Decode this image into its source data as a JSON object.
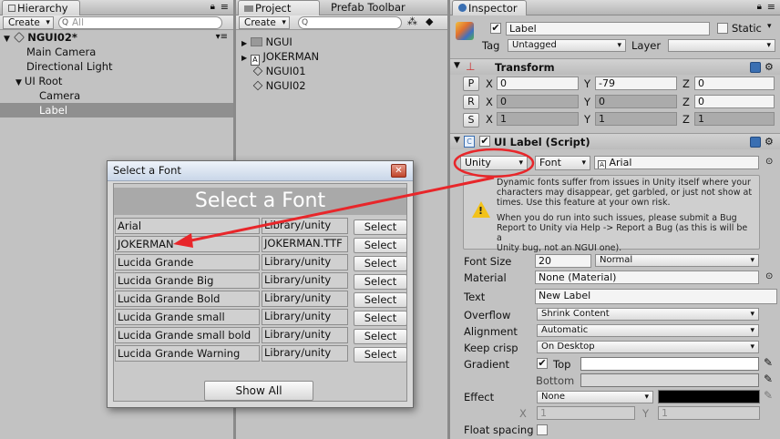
{
  "hierarchy": {
    "tab": "Hierarchy",
    "create": "Create",
    "search_placeholder": "All",
    "scene": "NGUI02*",
    "items": [
      "Main Camera",
      "Directional Light",
      "UI Root",
      "Camera",
      "Label"
    ]
  },
  "project": {
    "tab": "Project",
    "tab2": "Prefab Toolbar",
    "create": "Create",
    "items": [
      "NGUI",
      "JOKERMAN",
      "NGUI01",
      "NGUI02"
    ]
  },
  "inspector": {
    "tab": "Inspector",
    "object_name": "Label",
    "static_label": "Static",
    "tag_label": "Tag",
    "tag_value": "Untagged",
    "layer_label": "Layer",
    "layer_value": "",
    "transform": {
      "title": "Transform",
      "p": "P",
      "r": "R",
      "s": "S",
      "x": "X",
      "y": "Y",
      "z": "Z",
      "position": [
        "0",
        "-79",
        "0"
      ],
      "rotation": [
        "0",
        "0",
        "0"
      ],
      "scale": [
        "1",
        "1",
        "1"
      ]
    },
    "uilabel": {
      "title": "UI Label (Script)",
      "font_type": "Unity",
      "font_button": "Font",
      "font_value": "Arial",
      "help_lines": [
        "Dynamic fonts suffer from issues in Unity itself where your",
        "characters may disappear, get garbled, or just not show at",
        "times. Use this feature at your own risk.",
        "",
        "When you do run into such issues, please submit a Bug",
        "Report to Unity via Help -> Report a Bug (as this is will be a",
        "Unity bug, not an NGUI one)."
      ],
      "font_size_label": "Font Size",
      "font_size": "20",
      "font_style": "Normal",
      "material_label": "Material",
      "material_value": "None (Material)",
      "text_label": "Text",
      "text_value": "New Label",
      "overflow_label": "Overflow",
      "overflow_value": "Shrink Content",
      "alignment_label": "Alignment",
      "alignment_value": "Automatic",
      "keepcrisp_label": "Keep crisp",
      "keepcrisp_value": "On Desktop",
      "gradient_label": "Gradient",
      "top_label": "Top",
      "bottom_label": "Bottom",
      "effect_label": "Effect",
      "effect_value": "None",
      "effect_x_label": "X",
      "effect_x": "1",
      "effect_y_label": "Y",
      "effect_y": "1",
      "float_spacing_label": "Float spacing"
    }
  },
  "dialog": {
    "title": "Select a Font",
    "heading": "Select a Font",
    "show_all": "Show All",
    "select_label": "Select",
    "fonts": [
      {
        "name": "Arial",
        "path": "Library/unity"
      },
      {
        "name": "JOKERMAN",
        "path": "JOKERMAN.TTF"
      },
      {
        "name": "Lucida Grande",
        "path": "Library/unity"
      },
      {
        "name": "Lucida Grande Big",
        "path": "Library/unity"
      },
      {
        "name": "Lucida Grande Bold",
        "path": "Library/unity"
      },
      {
        "name": "Lucida Grande small",
        "path": "Library/unity"
      },
      {
        "name": "Lucida Grande small bold",
        "path": "Library/unity"
      },
      {
        "name": "Lucida Grande Warning",
        "path": "Library/unity"
      }
    ]
  },
  "colors": {
    "selection": "#8f8f8f",
    "annotation_red": "#e8262a",
    "effect_color": "#000000",
    "gradient_top": "#ffffff",
    "gradient_bottom": "#d8d8d8"
  }
}
